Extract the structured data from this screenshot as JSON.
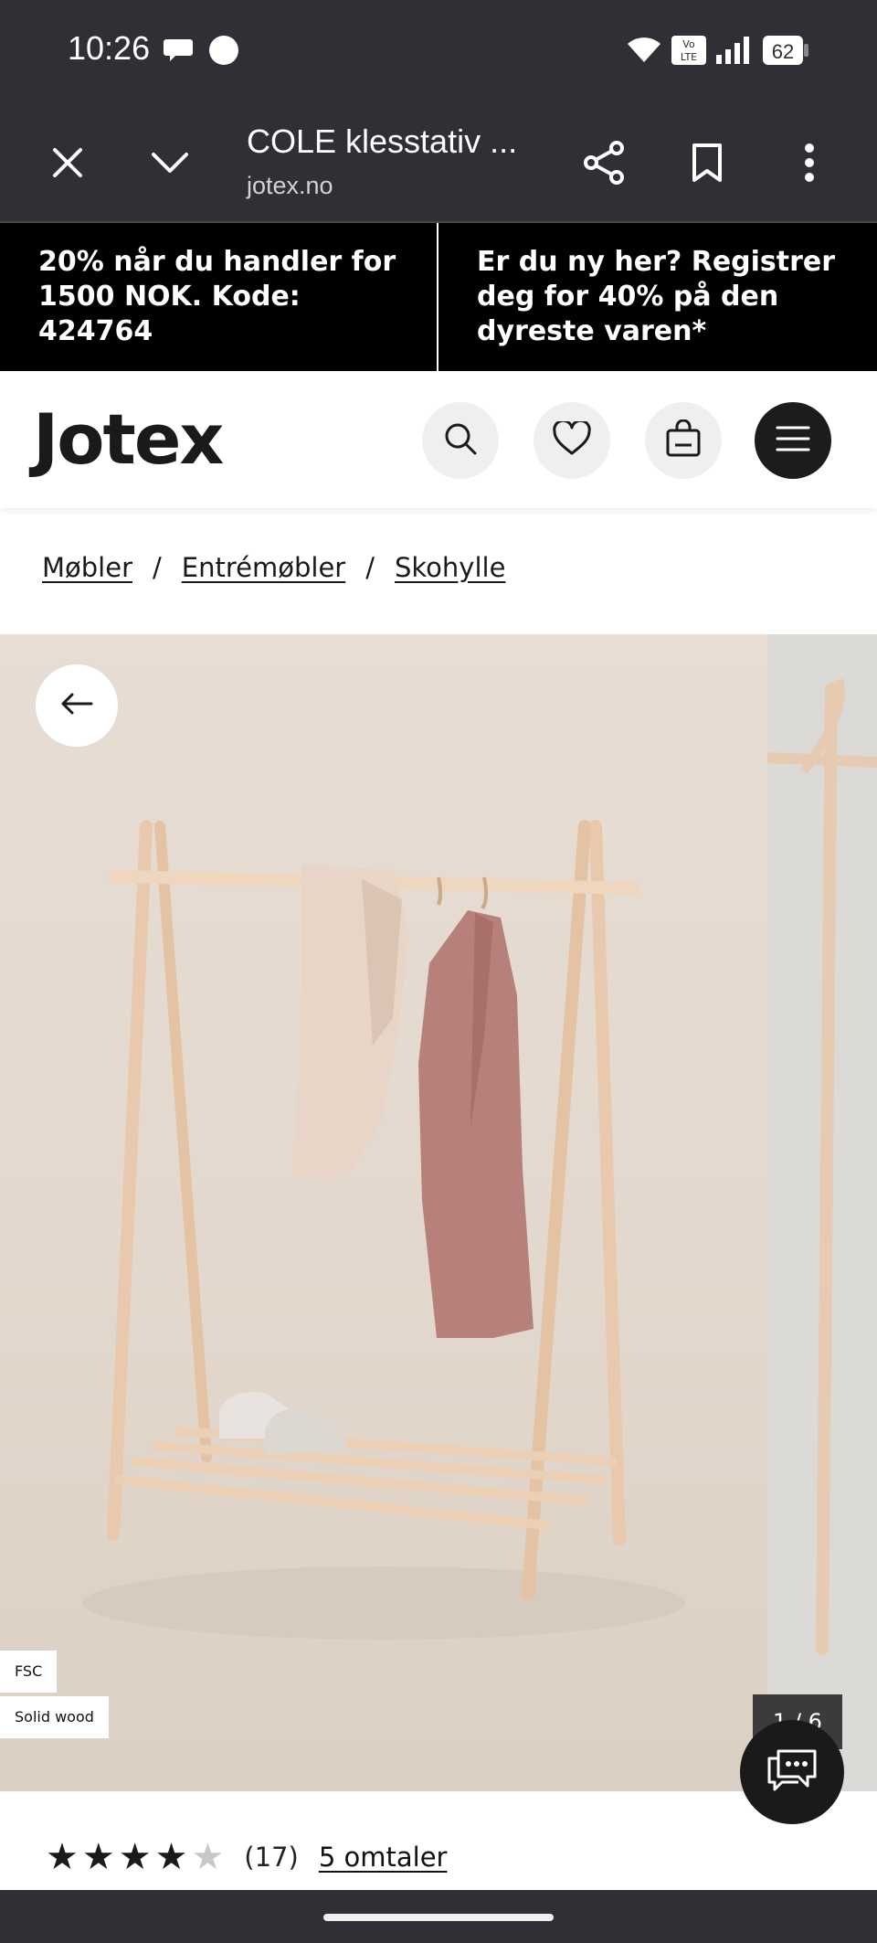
{
  "status_bar": {
    "time": "10:26",
    "battery": "62",
    "network": "Vo LTE"
  },
  "browser": {
    "page_title": "COLE klesstativ ...",
    "domain": "jotex.no",
    "icons": [
      "close-icon",
      "chevron-down-icon",
      "share-icon",
      "bookmark-icon",
      "more-vert-icon"
    ]
  },
  "promo": {
    "left_text": "20% når du handler for 1500 NOK. Kode: 424764",
    "right_text": "Er du ny her? Registrer deg for 40% på den dyreste varen*"
  },
  "header": {
    "logo": "Jotex",
    "icons": [
      "search-icon",
      "heart-icon",
      "bag-icon",
      "menu-icon"
    ]
  },
  "breadcrumb": {
    "items": [
      "Møbler",
      "Entrémøbler",
      "Skohylle"
    ],
    "separator": "/"
  },
  "gallery": {
    "tags": [
      "FSC",
      "Solid wood"
    ],
    "counter": "1 / 6"
  },
  "rating": {
    "stars": 4,
    "max_stars": 5,
    "count": "(17)",
    "reviews_link": "5 omtaler"
  },
  "colors": {
    "chrome": "#2e3035",
    "promo_bg": "#000000",
    "accent_dark": "#1c1c1c"
  }
}
